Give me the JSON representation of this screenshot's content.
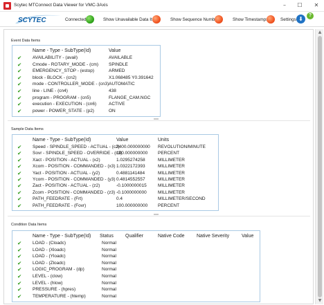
{
  "window": {
    "title": "Scytec MTConnect Data Viewer for VMC-3Axis",
    "minimize_glyph": "–",
    "maximize_glyph": "☐",
    "close_glyph": "✕",
    "app_icon": "app-icon"
  },
  "toolbar": {
    "logo_text": "SCYTEC",
    "connected_label": "Connected",
    "connected_status_color": "#2ea31a",
    "show_unavailable_label": "Show Unavailable Data Items",
    "show_sequence_label": "Show Sequence Numbers",
    "show_timestamps_label": "Show Timestamps",
    "toggle_off_color": "#f0511e",
    "settings_label": "Settings",
    "settings_glyph": "⬇",
    "help_glyph": "?"
  },
  "event_section": {
    "title": "Event Data Items",
    "headers": [
      "Name - Type - SubType(Id)",
      "Value"
    ],
    "rows": [
      [
        "AVAILABILITY - (avail)",
        "AVAILABLE"
      ],
      [
        "Cmode - ROTARY_MODE - (cm)",
        "SPINDLE"
      ],
      [
        "EMERGENCY_STOP - (estop)",
        "ARMED"
      ],
      [
        "block - BLOCK - (cn2)",
        "X1.068485 Y0.391642"
      ],
      [
        "mode - CONTROLLER_MODE - (cn3)",
        "AUTOMATIC"
      ],
      [
        "line - LINE - (cn4)",
        "438"
      ],
      [
        "program - PROGRAM - (cn5)",
        "FLANGE_CAM.NGC"
      ],
      [
        "execution - EXECUTION - (cn6)",
        "ACTIVE"
      ],
      [
        "power - POWER_STATE - (p2)",
        "ON"
      ]
    ]
  },
  "sample_section": {
    "title": "Sample Data Items",
    "headers": [
      "Name - Type - SubType(Id)",
      "Value",
      "Units"
    ],
    "rows": [
      [
        "Speed - SPINDLE_SPEED - ACTUAL - (c2)",
        "3400.000000000",
        "REVOLUTION/MINUTE"
      ],
      [
        "Sovr - SPINDLE_SPEED - OVERRIDE - (c3)",
        "100.000000000",
        "PERCENT"
      ],
      [
        "Xact - POSITION - ACTUAL - (x2)",
        "1.0295274258",
        "MILLIMETER"
      ],
      [
        "Xcom - POSITION - COMMANDED - (x3)",
        "1.0322172393",
        "MILLIMETER"
      ],
      [
        "Yact - POSITION - ACTUAL - (y2)",
        "0.4881141484",
        "MILLIMETER"
      ],
      [
        "Ycom - POSITION - COMMANDED - (y3)",
        "0.4814552557",
        "MILLIMETER"
      ],
      [
        "Zact - POSITION - ACTUAL - (z2)",
        "-0.1000000015",
        "MILLIMETER"
      ],
      [
        "Zcom - POSITION - COMMANDED - (z3)",
        "-0.1000000000",
        "MILLIMETER"
      ],
      [
        "PATH_FEEDRATE - (Frt)",
        "0.4",
        "MILLIMETER/SECOND"
      ],
      [
        "PATH_FEEDRATE - (Fovr)",
        "100.000000000",
        "PERCENT"
      ]
    ]
  },
  "condition_section": {
    "title": "Condition Data Items",
    "headers": [
      "Name - Type - SubType(Id)",
      "Status",
      "Qualifier",
      "Native Code",
      "Native Severity",
      "Value"
    ],
    "rows": [
      [
        "LOAD - (Cloadc)",
        "Normal"
      ],
      [
        "LOAD - (Xloadc)",
        "Normal"
      ],
      [
        "LOAD - (Yloadc)",
        "Normal"
      ],
      [
        "LOAD - (Zloadc)",
        "Normal"
      ],
      [
        "LOGIC_PROGRAM - (dp)",
        "Normal"
      ],
      [
        "LEVEL - (clow)",
        "Normal"
      ],
      [
        "LEVEL - (hlow)",
        "Normal"
      ],
      [
        "PRESSURE - (hpres)",
        "Normal"
      ],
      [
        "TEMPERATURE - (htemp)",
        "Normal"
      ]
    ]
  },
  "check_glyph": "✔",
  "scroll": {
    "up_glyph": "▲",
    "down_glyph": "▼"
  }
}
